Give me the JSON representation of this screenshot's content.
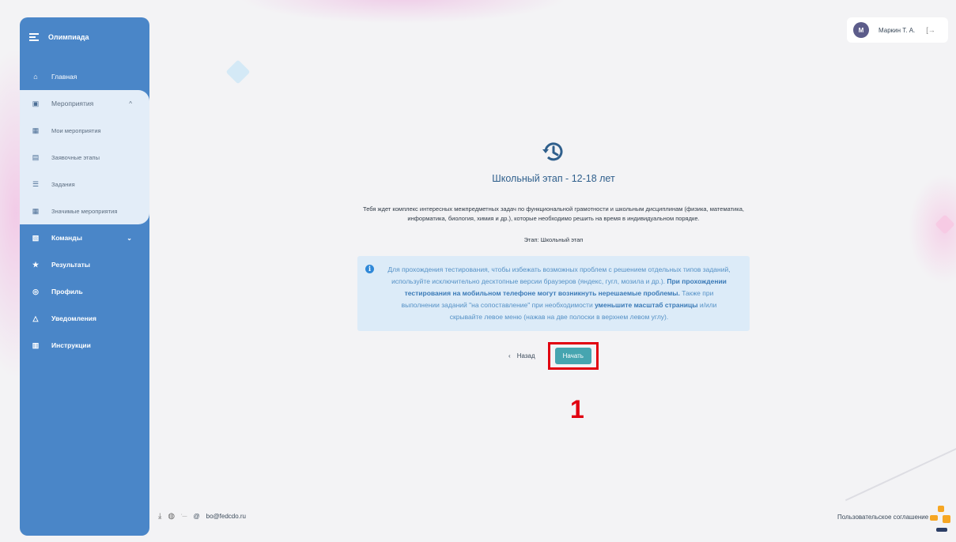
{
  "sidebar": {
    "title": "Олимпиада",
    "items": [
      {
        "label": "Главная",
        "icon": "home-icon"
      },
      {
        "label": "Мероприятия",
        "icon": "calendar-icon"
      },
      {
        "label": "Мои мероприятия",
        "icon": "calendar-grid-icon"
      },
      {
        "label": "Заявочные этапы",
        "icon": "list-box-icon"
      },
      {
        "label": "Задания",
        "icon": "tasks-icon"
      },
      {
        "label": "Значимые мероприятия",
        "icon": "calendar-star-icon"
      },
      {
        "label": "Команды",
        "icon": "clipboard-icon"
      },
      {
        "label": "Результаты",
        "icon": "trophy-icon"
      },
      {
        "label": "Профиль",
        "icon": "user-icon"
      },
      {
        "label": "Уведомления",
        "icon": "bell-icon"
      },
      {
        "label": "Инструкции",
        "icon": "book-icon"
      }
    ]
  },
  "user": {
    "initial": "М",
    "name": "Маркин Т. А."
  },
  "main": {
    "title": "Школьный этап - 12-18 лет",
    "description": "Тебя ждет комплекс интересных межпредметных задач по функциональной грамотности и школьным дисциплинам (физика, математика, информатика, биология, химия и др.), которые необходимо решить на время в индивидуальном порядке.",
    "stage": "Этап: Школьный этап",
    "notice": {
      "part1": "Для прохождения тестирования, чтобы избежать возможных проблем с решением отдельных типов заданий, используйте исключительно десктопные версии браузеров (яндекс, гугл, мозила и др.). ",
      "bold1": "При прохождении тестирования на мобильном телефоне могут возникнуть нерешаемые проблемы.",
      "part2": " Также при выполнении заданий \"на сопоставление\" при необходимости ",
      "bold2": "уменьшите масштаб страницы",
      "part3": " и/или скрывайте левое меню (нажав на две полоски в верхнем левом углу)."
    },
    "back_label": "Назад",
    "start_label": "Начать"
  },
  "annotation": {
    "marker": "1",
    "color": "#e10010"
  },
  "footer": {
    "email": "bo@fedcdo.ru",
    "agreement": "Пользовательское соглашение"
  },
  "colors": {
    "sidebar": "#4a86c8",
    "accent": "#46a5b0",
    "notice_bg": "#dcebf8"
  }
}
